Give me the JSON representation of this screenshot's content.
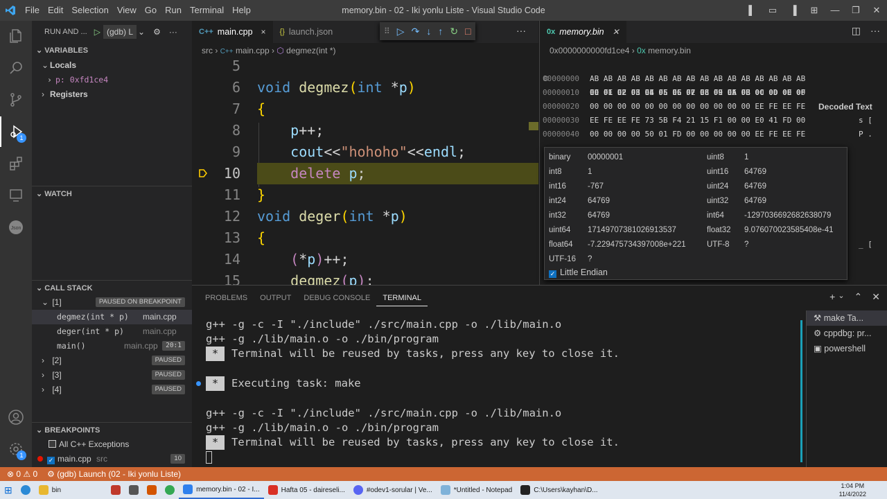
{
  "titlebar": {
    "menu": [
      "File",
      "Edit",
      "Selection",
      "View",
      "Go",
      "Run",
      "Terminal",
      "Help"
    ],
    "title": "memory.bin - 02 - Iki yonlu Liste - Visual Studio Code"
  },
  "sidebar": {
    "header": "RUN AND ...",
    "config": "(gdb) L",
    "variables_title": "VARIABLES",
    "locals_label": "Locals",
    "local_var": "p: 0xfd1ce4",
    "registers_label": "Registers",
    "watch_title": "WATCH",
    "callstack_title": "CALL STACK",
    "threads": [
      {
        "label": "[1]",
        "status": "PAUSED ON BREAKPOINT"
      },
      {
        "label": "[2]",
        "status": "PAUSED"
      },
      {
        "label": "[3]",
        "status": "PAUSED"
      },
      {
        "label": "[4]",
        "status": "PAUSED"
      }
    ],
    "frames": [
      {
        "name": "degmez(int * p)",
        "file": "main.cpp",
        "pos": ""
      },
      {
        "name": "deger(int * p)",
        "file": "main.cpp",
        "pos": ""
      },
      {
        "name": "main()",
        "file": "main.cpp",
        "pos": "20:1"
      }
    ],
    "breakpoints_title": "BREAKPOINTS",
    "breakpoints": [
      {
        "label": "All C++ Exceptions",
        "dir": "",
        "count": ""
      },
      {
        "label": "main.cpp",
        "dir": "src",
        "count": "10"
      }
    ]
  },
  "activity_badges": {
    "debug": "1",
    "account": "1"
  },
  "editor": {
    "tabs": [
      {
        "icon": "C++",
        "label": "main.cpp",
        "close": "×"
      },
      {
        "icon": "{}",
        "label": "launch.json"
      }
    ],
    "breadcrumb": [
      "src",
      "main.cpp",
      "degmez(int *)"
    ],
    "line_numbers": [
      "5",
      "6",
      "7",
      "8",
      "9",
      "10",
      "11",
      "12",
      "13",
      "14",
      "15"
    ],
    "current_line": "10"
  },
  "hex": {
    "tab_label": "memory.bin",
    "tab_icon": "0x",
    "address": "0x0000000000fd1ce4",
    "header_bytes": "00 01 02 03 04 05 06 07 08 09 0A 0B 0C 0D 0E 0F",
    "decoded_label": "Decoded Text",
    "rows": [
      {
        "off": "00000000",
        "bytes": "AB AB AB AB AB AB AB AB AB AB AB AB AB AB AB AB",
        "dec": ""
      },
      {
        "off": "00000010",
        "bytes": "EE FE EE FE EE FE EE FE EE FE EE FE 00 00 00 00",
        "dec": ""
      },
      {
        "off": "00000020",
        "bytes": "00 00 00 00 00 00 00 00 00 00 00 00 EE FE EE FE",
        "dec": ""
      },
      {
        "off": "00000030",
        "bytes": "EE FE EE FE 73 5B F4 21 15 F1 00 00 E0 41 FD 00",
        "dec": "s ["
      },
      {
        "off": "00000040",
        "bytes": "00 00 00 00 50 01 FD 00 00 00 00 00 EE FE EE FE",
        "dec": "P ."
      }
    ],
    "inspector": [
      {
        "k": "binary",
        "v": "00000001"
      },
      {
        "k": "uint8",
        "v": "1"
      },
      {
        "k": "int8",
        "v": "1"
      },
      {
        "k": "uint16",
        "v": "64769"
      },
      {
        "k": "int16",
        "v": "-767"
      },
      {
        "k": "uint24",
        "v": "64769"
      },
      {
        "k": "int24",
        "v": "64769"
      },
      {
        "k": "uint32",
        "v": "64769"
      },
      {
        "k": "int32",
        "v": "64769"
      },
      {
        "k": "int64",
        "v": "-1297036692682638079"
      },
      {
        "k": "uint64",
        "v": "17149707381026913537"
      },
      {
        "k": "float32",
        "v": "9.076070023585408e-41"
      },
      {
        "k": "float64",
        "v": "-7.229475734397008e+221"
      },
      {
        "k": "UTF-8",
        "v": "?"
      },
      {
        "k": "UTF-16",
        "v": "?"
      }
    ],
    "little_endian": "Little Endian",
    "side_marks": [
      "_ ["
    ]
  },
  "panel": {
    "tabs": [
      "PROBLEMS",
      "OUTPUT",
      "DEBUG CONSOLE",
      "TERMINAL"
    ],
    "terminal_lines": [
      {
        "text": "g++ -g -c -I \"./include\" ./src/main.cpp -o ./lib/main.o",
        "star": false,
        "dot": false
      },
      {
        "text": "g++ -g ./lib/main.o -o ./bin/program",
        "star": false,
        "dot": false
      },
      {
        "text": "Terminal will be reused by tasks, press any key to close it.",
        "star": true,
        "dot": false
      },
      {
        "text": "",
        "star": false,
        "dot": false
      },
      {
        "text": "Executing task: make",
        "star": true,
        "dot": true
      },
      {
        "text": "",
        "star": false,
        "dot": false
      },
      {
        "text": "g++ -g -c -I \"./include\" ./src/main.cpp -o ./lib/main.o",
        "star": false,
        "dot": false
      },
      {
        "text": "g++ -g ./lib/main.o -o ./bin/program",
        "star": false,
        "dot": false
      },
      {
        "text": "Terminal will be reused by tasks, press any key to close it.",
        "star": true,
        "dot": false
      }
    ],
    "star_glyph": "*",
    "terminals": [
      "make  Ta...",
      "cppdbg: pr...",
      "powershell"
    ]
  },
  "statusbar": {
    "problems": "⊗ 0  ⚠ 0",
    "launch": "⚙ (gdb) Launch (02 - Iki yonlu Liste)"
  },
  "taskbar": {
    "items": [
      "bin",
      "memory.bin - 02 - I...",
      "Hafta 05 - daireseli...",
      "#odev1-sorular | Ve...",
      "*Untitled - Notepad",
      "C:\\Users\\kayhan\\D..."
    ],
    "time": "1:04 PM",
    "date": "11/4/2022"
  }
}
